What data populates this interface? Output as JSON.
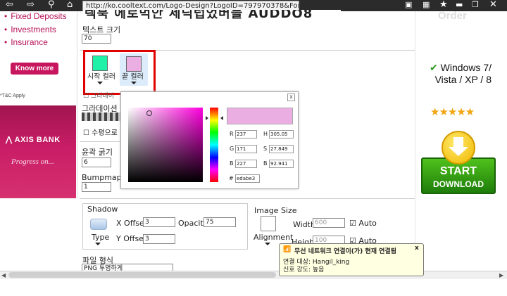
{
  "browser": {
    "url": "http://ko.cooltext.com/Logo-Design?LogoID=797970378&Font=11156"
  },
  "page_title_partial": "렉북 에로먹안 세딕럽었버블 AUDDO8",
  "left_ad": {
    "items": [
      "Fixed Deposits",
      "Investments",
      "Insurance"
    ],
    "button": "Know more",
    "footnote": "*T&C Apply",
    "bank": "AXIS BANK",
    "tagline": "Progress on..."
  },
  "form": {
    "text_size_label": "텍스트 크기",
    "text_size_value": "70",
    "start_color_label": "시작 컬러",
    "end_color_label": "끝 컬러",
    "start_color": "#1ff2a8",
    "end_color": "#ebaee3",
    "gradient_partial": "그라데이",
    "gradient_label": "그라데이션",
    "horizontal_partial": "수평으로",
    "outline_label": "윤곽 굵기",
    "outline_value": "6",
    "bumpmap_label": "Bumpmap 부",
    "bumpmap_value": "1",
    "shadow_label": "Shadow",
    "type_label": "Type",
    "x_offset_label": "X Offset",
    "x_offset_value": "3",
    "y_offset_label": "Y Offset",
    "y_offset_value": "3",
    "opacity_label": "Opacity",
    "opacity_value": "75",
    "image_size_label": "Image Size",
    "alignment_label": "Alignment",
    "width_label": "Width",
    "width_value": "600",
    "height_label": "Height",
    "height_value": "100",
    "auto_label": "Auto",
    "file_format_label": "파일 형식",
    "file_format_value": "PNG 투명하게"
  },
  "picker": {
    "close": "x",
    "r_label": "R",
    "r_value": "237",
    "g_label": "G",
    "g_value": "171",
    "b_label": "B",
    "b_value": "227",
    "h_label": "H",
    "h_value": "305.05",
    "s_label": "S",
    "s_value": "27.849",
    "br_label": "B",
    "br_value": "92.941",
    "hex_label": "#",
    "hex_value": "edabe3"
  },
  "right_ad": {
    "os_line1": "Windows 7/",
    "os_line2": "Vista / XP / 8",
    "stars": "★★★★★",
    "start": "START",
    "download": "DOWNLOAD"
  },
  "tooltip": {
    "title": "무선 네트워크 연결이(가) 현재 연결됨",
    "line1": "연결 대상: Hangil_king",
    "line2": "신호 강도: 높음",
    "close": "x"
  },
  "ghost_text": "Order"
}
